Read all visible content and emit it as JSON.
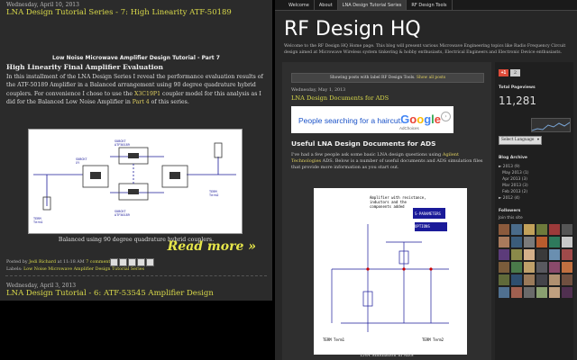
{
  "left": {
    "date": "Wednesday, April 10, 2013",
    "post_title": "LNA Design Tutorial Series - 7: High Linearity ATF-50189",
    "subheading": "Low Noise Microwave Amplifier Design Tutorial - Part 7",
    "bold_title": "High Linearity Final Amplifier Evaluation",
    "para_1": "In this installment of the LNA Design Series I reveal the performance evaluation results of the ATF-50189 Amplifier in a Balanced arrangement using 90 degree quadrature hybrid couplers. For convenience I chose to use the ",
    "para_link_1": "X3C19P1",
    "para_2": " coupler model for this analysis as I did for the Balanced Low Noise Amplifier in ",
    "para_link_2": "Part 4",
    "para_3": " of this series.",
    "caption": "Balanced using 90 degree quadrature hybrid couplers.",
    "read_more": "Read more »",
    "posted_by_prefix": "Posted by ",
    "author": "Jedi Richard",
    "posted_time": " at 11:18 AM ",
    "comments": "7 comments",
    "labels_prefix": "Labels: ",
    "labels": "Low Noise Microwave Amplifier Design Tutorial Series",
    "date_2": "Wednesday, April 3, 2013",
    "post_title_2": "LNA Design Tutorial - 6: ATF-53545 Amplifier Design"
  },
  "right": {
    "nav": [
      "Welcome",
      "About",
      "LNA Design Tutorial Series",
      "RF Design Tools"
    ],
    "blog_title": "RF Design HQ",
    "description": "Welcome to the RF Design HQ Home page. This blog will present various Microwave Engineering topics like Radio Frequency Circuit design aimed at Microwave Wireless system tinkering & hobby enthusiasts, Electrical Engineers and Electronic Device enthusiasts.",
    "notice_text": "Showing posts with label RF Design Tools. ",
    "notice_link": "Show all posts",
    "date": "Wednesday, May 1, 2013",
    "post_title": "LNA Design Documents for ADS",
    "ad_text": "People searching for a haircut.",
    "ad_small": "AdChoices",
    "post_heading": "Useful LNA Design Documents for ADS",
    "para_1": "I've had a few people ask some basic LNA design questions using ",
    "para_link": "Agilent Technologies",
    "para_2": " ADS. Below is a number of useful documents and ADS simulation files that provide more information as you start out.",
    "figure_caption": "LNA Simulation in ADS",
    "sidebar": {
      "gplus_label": "+1",
      "gplus_count": "2",
      "total_title": "Total Pageviews",
      "total_count": "11,281",
      "translate_select": "Select Language",
      "archive_title": "Blog Archive",
      "archive": "► 2013 (9)\n   May 2013 (1)\n   Apr 2013 (3)\n   Mar 2013 (3)\n   Feb 2013 (2)\n► 2012 (4)",
      "followers_title": "Followers",
      "followers_label": "Join this site"
    }
  },
  "colors": {
    "link_yellow": "#d9d94a",
    "google_blue": "#4285f4",
    "google_red": "#ea4335",
    "google_yellow": "#fbbc05",
    "google_green": "#34a853"
  }
}
